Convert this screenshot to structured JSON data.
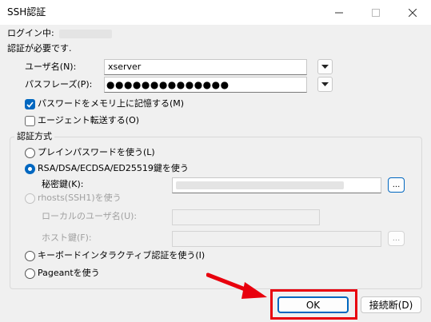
{
  "window": {
    "title": "SSH認証"
  },
  "login": {
    "label": "ログイン中:"
  },
  "auth_required": "認証が必要です.",
  "username": {
    "label": "ユーザ名(N):",
    "value": "xserver"
  },
  "passphrase": {
    "label": "パスフレーズ(P):",
    "value": "●●●●●●●●●●●●●●"
  },
  "options": {
    "remember_password": "パスワードをメモリ上に記憶する(M)",
    "agent_forwarding": "エージェント転送する(O)"
  },
  "auth_method": {
    "group_label": "認証方式",
    "plain_password": "プレインパスワードを使う(L)",
    "rsa_key": "RSA/DSA/ECDSA/ED25519鍵を使う",
    "private_key_label": "秘密鍵(K):",
    "browse_label": "...",
    "rhosts": "rhosts(SSH1)を使う",
    "local_user_label": "ローカルのユーザ名(U):",
    "host_key_label": "ホスト鍵(F):",
    "keyboard_interactive": "キーボードインタラクティブ認証を使う(I)",
    "pageant": "Pageantを使う"
  },
  "buttons": {
    "ok": "OK",
    "disconnect": "接続断(D)"
  },
  "colors": {
    "accent": "#0067c0",
    "highlight_red": "#e8000d"
  }
}
